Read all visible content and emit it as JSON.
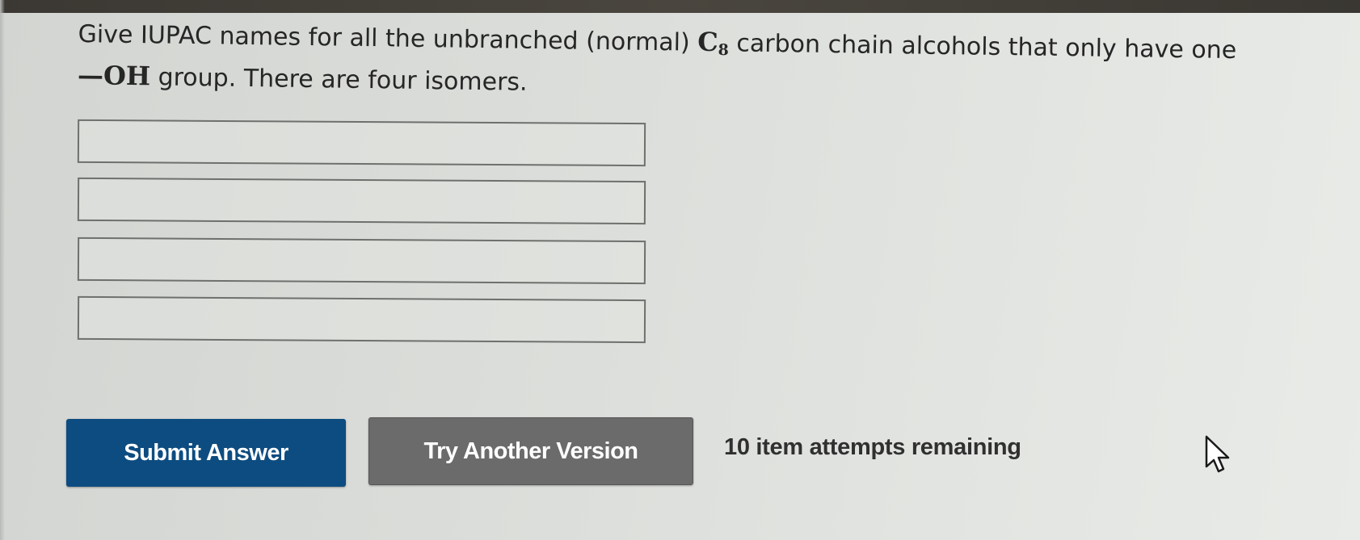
{
  "question": {
    "part1": "Give IUPAC names for all the unbranched (normal) ",
    "formula_symbol": "C",
    "formula_subscript": "8",
    "part2": " carbon chain alcohols that only have one",
    "group_text": "—OH",
    "part3": " group. There are four isomers."
  },
  "answers": [
    {
      "value": ""
    },
    {
      "value": ""
    },
    {
      "value": ""
    },
    {
      "value": ""
    }
  ],
  "buttons": {
    "submit_label": "Submit Answer",
    "try_label": "Try Another Version"
  },
  "attempts_text": "10 item attempts remaining",
  "icons": {
    "pointer": "mouse-pointer-icon"
  },
  "colors": {
    "submit_bg": "#0d4c80",
    "try_bg": "#6b6b6b"
  }
}
